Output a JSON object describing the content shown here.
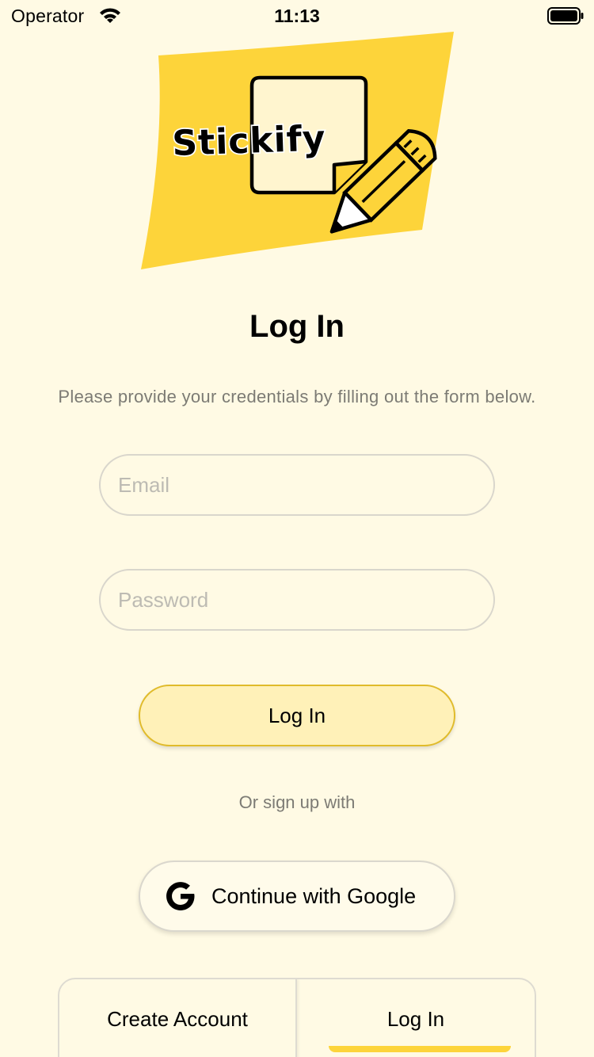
{
  "status_bar": {
    "carrier": "Operator",
    "time": "11:13"
  },
  "logo": {
    "text": "Stickify",
    "background_color": "#fdd43a"
  },
  "header": {
    "title": "Log In",
    "subtitle": "Please provide your credentials by filling out the form below."
  },
  "form": {
    "email_placeholder": "Email",
    "email_value": "",
    "password_placeholder": "Password",
    "password_value": "",
    "submit_label": "Log In"
  },
  "social": {
    "divider_text": "Or sign up with",
    "google_label": "Continue with Google"
  },
  "tabs": {
    "items": [
      {
        "label": "Create Account",
        "selected": false
      },
      {
        "label": "Log In",
        "selected": true
      }
    ]
  },
  "colors": {
    "background": "#fffae4",
    "accent": "#fdd43a",
    "button_fill": "#fff1b8",
    "button_border": "#e0bb2b",
    "muted_text": "#7c7b74"
  }
}
